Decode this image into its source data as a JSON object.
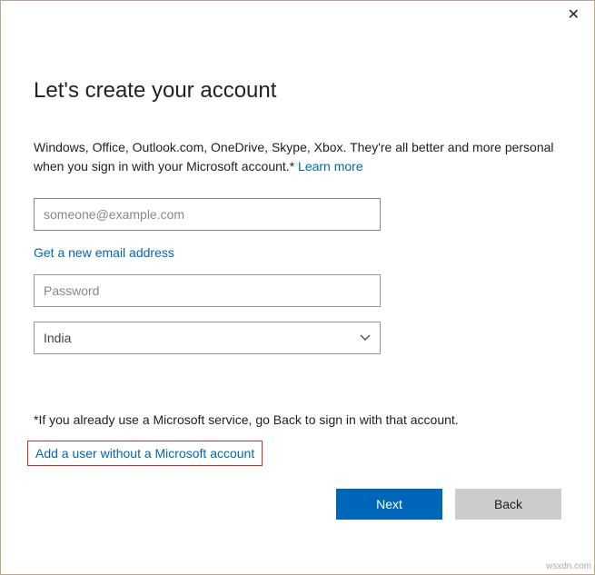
{
  "header": {
    "title": "Let's create your account"
  },
  "description": {
    "text": "Windows, Office, Outlook.com, OneDrive, Skype, Xbox. They're all better and more personal when you sign in with your Microsoft account.* ",
    "learn_more": "Learn more"
  },
  "form": {
    "email_placeholder": "someone@example.com",
    "email_value": "",
    "get_email_link": "Get a new email address",
    "password_placeholder": "Password",
    "password_value": "",
    "country_value": "India"
  },
  "footer": {
    "note": "*If you already use a Microsoft service, go Back to sign in with that account.",
    "add_user_link": "Add a user without a Microsoft account"
  },
  "buttons": {
    "next": "Next",
    "back": "Back"
  },
  "watermark": "wsxdn.com"
}
